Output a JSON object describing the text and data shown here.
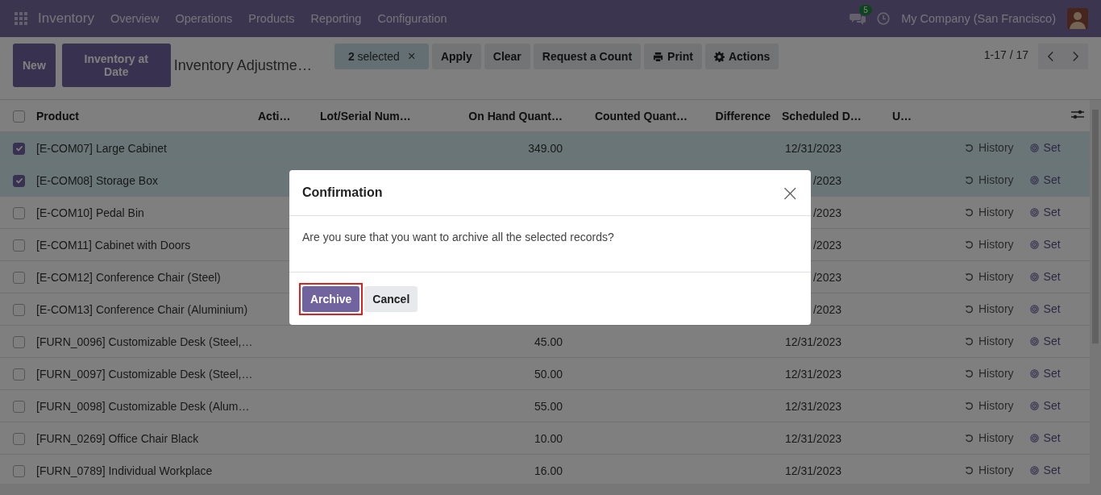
{
  "navbar": {
    "app": "Inventory",
    "menu": [
      "Overview",
      "Operations",
      "Products",
      "Reporting",
      "Configuration"
    ],
    "messages_badge": "5",
    "company": "My Company (San Francisco)"
  },
  "control_panel": {
    "buttons": [
      "New",
      "Inventory at Date"
    ],
    "breadcrumb": "Inventory Adjustme…",
    "selection": "**2** selected",
    "clear_selection": "×",
    "actions": [
      {
        "label": "Apply",
        "kind": "plain"
      },
      {
        "label": "Clear",
        "kind": "plain"
      },
      {
        "label": "Request a Count",
        "kind": "plain"
      },
      {
        "label": "Print",
        "kind": "print"
      },
      {
        "label": "Actions",
        "kind": "menu"
      }
    ],
    "pager": "1-17 / 17"
  },
  "table": {
    "all_checked": false,
    "columns": [
      "Product",
      "Acti…",
      "Lot/Serial Num…",
      "On Hand Quant…",
      "Counted Quant…",
      "Difference",
      "Scheduled D…",
      "U…"
    ],
    "rows": [
      {
        "selected": true,
        "product": "[E-COM07] Large Cabinet",
        "on_hand": "349.00",
        "scheduled": "12/31/2023",
        "history": "History",
        "set": "Set"
      },
      {
        "selected": true,
        "product": "[E-COM08] Storage Box",
        "scheduled": "/2023",
        "history": "History",
        "set": "Set"
      },
      {
        "selected": false,
        "product": "[E-COM10] Pedal Bin",
        "scheduled": "/2023",
        "history": "History",
        "set": "Set"
      },
      {
        "selected": false,
        "product": "[E-COM11] Cabinet with Doors",
        "scheduled": "/2023",
        "history": "History",
        "set": "Set"
      },
      {
        "selected": false,
        "product": "[E-COM12] Conference Chair (Steel)",
        "scheduled": "/2023",
        "history": "History",
        "set": "Set"
      },
      {
        "selected": false,
        "product": "[E-COM13] Conference Chair (Aluminium)",
        "scheduled": "/2023",
        "history": "History",
        "set": "Set"
      },
      {
        "selected": false,
        "product": "[FURN_0096] Customizable Desk (Steel,…",
        "on_hand": "45.00",
        "scheduled": "12/31/2023",
        "history": "History",
        "set": "Set"
      },
      {
        "selected": false,
        "product": "[FURN_0097] Customizable Desk (Steel,…",
        "on_hand": "50.00",
        "scheduled": "12/31/2023",
        "history": "History",
        "set": "Set"
      },
      {
        "selected": false,
        "product": "[FURN_0098] Customizable Desk (Alum…",
        "on_hand": "55.00",
        "scheduled": "12/31/2023",
        "history": "History",
        "set": "Set"
      },
      {
        "selected": false,
        "product": "[FURN_0269] Office Chair Black",
        "on_hand": "10.00",
        "scheduled": "12/31/2023",
        "history": "History",
        "set": "Set"
      },
      {
        "selected": false,
        "product": "[FURN_0789] Individual Workplace",
        "on_hand": "16.00",
        "scheduled": "12/31/2023",
        "history": "History",
        "set": "Set"
      }
    ]
  },
  "dialog": {
    "title": "Confirmation",
    "close": "×",
    "message": "Are you sure that you want to archive all the selected records?",
    "buttons": [
      {
        "label": "Archive",
        "kind": "primary",
        "highlighted": true
      },
      {
        "label": "Cancel",
        "kind": "secondary",
        "highlighted": false
      }
    ]
  }
}
